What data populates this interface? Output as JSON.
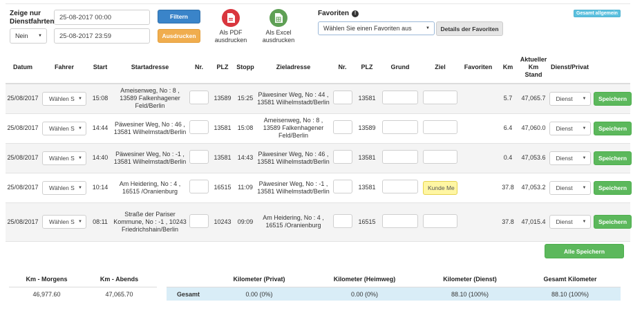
{
  "filters": {
    "show_label": "Zeige nur Dienstfahrten:",
    "show_select": "Nein",
    "date_from": "25-08-2017 00:00",
    "date_to": "25-08-2017 23:59",
    "filter_button": "Filtern",
    "print_button": "Ausdrucken"
  },
  "exports": {
    "pdf_label": "Als PDF ausdrucken",
    "excel_label": "Als Excel ausdrucken"
  },
  "favorites": {
    "title": "Favoriten",
    "select_placeholder": "Wählen Sie einen Favoriten aus",
    "details_button": "Details der Favoriten"
  },
  "badge": "Gesamt allgemein",
  "table": {
    "headers": {
      "datum": "Datum",
      "fahrer": "Fahrer",
      "start": "Start",
      "startadresse": "Startadresse",
      "nr1": "Nr.",
      "plz1": "PLZ",
      "stopp": "Stopp",
      "zieladresse": "Zieladresse",
      "nr2": "Nr.",
      "plz2": "PLZ",
      "grund": "Grund",
      "ziel": "Ziel",
      "favoriten": "Favoriten",
      "km": "Km",
      "stand": "Aktueller Km Stand",
      "dienst": "Dienst/Privat"
    },
    "rows": [
      {
        "date": "25/08/2017",
        "driver": "Wählen S",
        "start": "15:08",
        "start_addr": "Ameisenweg, No : 8 , 13589 Falkenhagener Feld/Berlin",
        "plz1": "13589",
        "stop": "15:25",
        "dest_addr": "Päwesiner Weg, No : 44 , 13581 Wilhelmstadt/Berlin",
        "plz2": "13581",
        "ziel": "",
        "km": "5.7",
        "stand": "47,065.7",
        "type": "Dienst",
        "save": "Speichern"
      },
      {
        "date": "25/08/2017",
        "driver": "Wählen S",
        "start": "14:44",
        "start_addr": "Päwesiner Weg, No : 46 , 13581 Wilhelmstadt/Berlin",
        "plz1": "13581",
        "stop": "15:08",
        "dest_addr": "Ameisenweg, No : 8 , 13589 Falkenhagener Feld/Berlin",
        "plz2": "13589",
        "ziel": "",
        "km": "6.4",
        "stand": "47,060.0",
        "type": "Dienst",
        "save": "Speichern"
      },
      {
        "date": "25/08/2017",
        "driver": "Wählen S",
        "start": "14:40",
        "start_addr": "Päwesiner Weg, No : -1 , 13581 Wilhelmstadt/Berlin",
        "plz1": "13581",
        "stop": "14:43",
        "dest_addr": "Päwesiner Weg, No : 46 , 13581 Wilhelmstadt/Berlin",
        "plz2": "13581",
        "ziel": "",
        "km": "0.4",
        "stand": "47,053.6",
        "type": "Dienst",
        "save": "Speichern"
      },
      {
        "date": "25/08/2017",
        "driver": "Wählen S",
        "start": "10:14",
        "start_addr": "Am Heidering, No : 4 , 16515 /Oranienburg",
        "plz1": "16515",
        "stop": "11:09",
        "dest_addr": "Päwesiner Weg, No : -1 , 13581 Wilhelmstadt/Berlin",
        "plz2": "13581",
        "ziel": "Kunde Me",
        "km": "37.8",
        "stand": "47,053.2",
        "type": "Dienst",
        "save": "Speichern"
      },
      {
        "date": "25/08/2017",
        "driver": "Wählen S",
        "start": "08:11",
        "start_addr": "Straße der Pariser Kommune, No : -1 , 10243 Friedrichshain/Berlin",
        "plz1": "10243",
        "stop": "09:09",
        "dest_addr": "Am Heidering, No : 4 , 16515 /Oranienburg",
        "plz2": "16515",
        "ziel": "",
        "km": "37.8",
        "stand": "47,015.4",
        "type": "Dienst",
        "save": "Speichern"
      }
    ]
  },
  "save_all": "Alle Speichern",
  "km_summary": {
    "morning_label": "Km - Morgens",
    "evening_label": "Km - Abends",
    "morning_value": "46,977.60",
    "evening_value": "47,065.70"
  },
  "totals": {
    "private_label": "Kilometer (Privat)",
    "home_label": "Kilometer (Heimweg)",
    "business_label": "Kilometer (Dienst)",
    "total_label": "Gesamt Kilometer",
    "row_label": "Gesamt",
    "private_value": "0.00 (0%)",
    "home_value": "0.00 (0%)",
    "business_value": "88.10 (100%)",
    "total_value": "88.10 (100%)"
  },
  "colors": {
    "primary": "#3a84c9",
    "warning": "#f0ad4e",
    "success": "#5cb85c",
    "info": "#5bc0de",
    "pdf_icon": "#d9363e",
    "excel_icon": "#5fa055"
  }
}
